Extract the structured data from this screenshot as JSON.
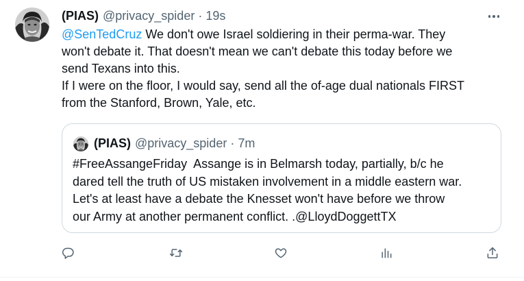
{
  "tweet": {
    "author_name": "(PIAS)",
    "author_handle": "@privacy_spider",
    "separator": "·",
    "time": "19s",
    "avatar_icon": "avatar-photo",
    "more_icon": "more-horizontal-icon",
    "body": {
      "mention": "@SenTedCruz",
      "line1_rest": " We don't owe Israel soldiering in their perma-war. They",
      "line2": "won't debate it. That doesn't mean we can't debate this today before we",
      "line3": "send Texans into this.",
      "line4": "If I were on the floor, I would say, send all the of-age dual nationals FIRST",
      "line5": "from the Stanford, Brown, Yale, etc."
    }
  },
  "quoted_tweet": {
    "author_name": "(PIAS)",
    "author_handle": "@privacy_spider",
    "separator": "·",
    "time": "7m",
    "lines": [
      "#FreeAssangeFriday  Assange is in Belmarsh today, partially, b/c he",
      "dared tell the truth of US mistaken involvement in a middle eastern war.",
      "Let's at least have a debate the Knesset won't have before we throw",
      "our Army at another permanent conflict. .@LloydDoggettTX"
    ]
  },
  "actions": {
    "reply_icon": "reply-icon",
    "retweet_icon": "retweet-icon",
    "like_icon": "heart-icon",
    "views_icon": "analytics-icon",
    "share_icon": "share-icon"
  },
  "colors": {
    "text": "#0f1419",
    "secondary": "#536471",
    "link": "#1d9bf0",
    "border": "#cfd9de"
  }
}
